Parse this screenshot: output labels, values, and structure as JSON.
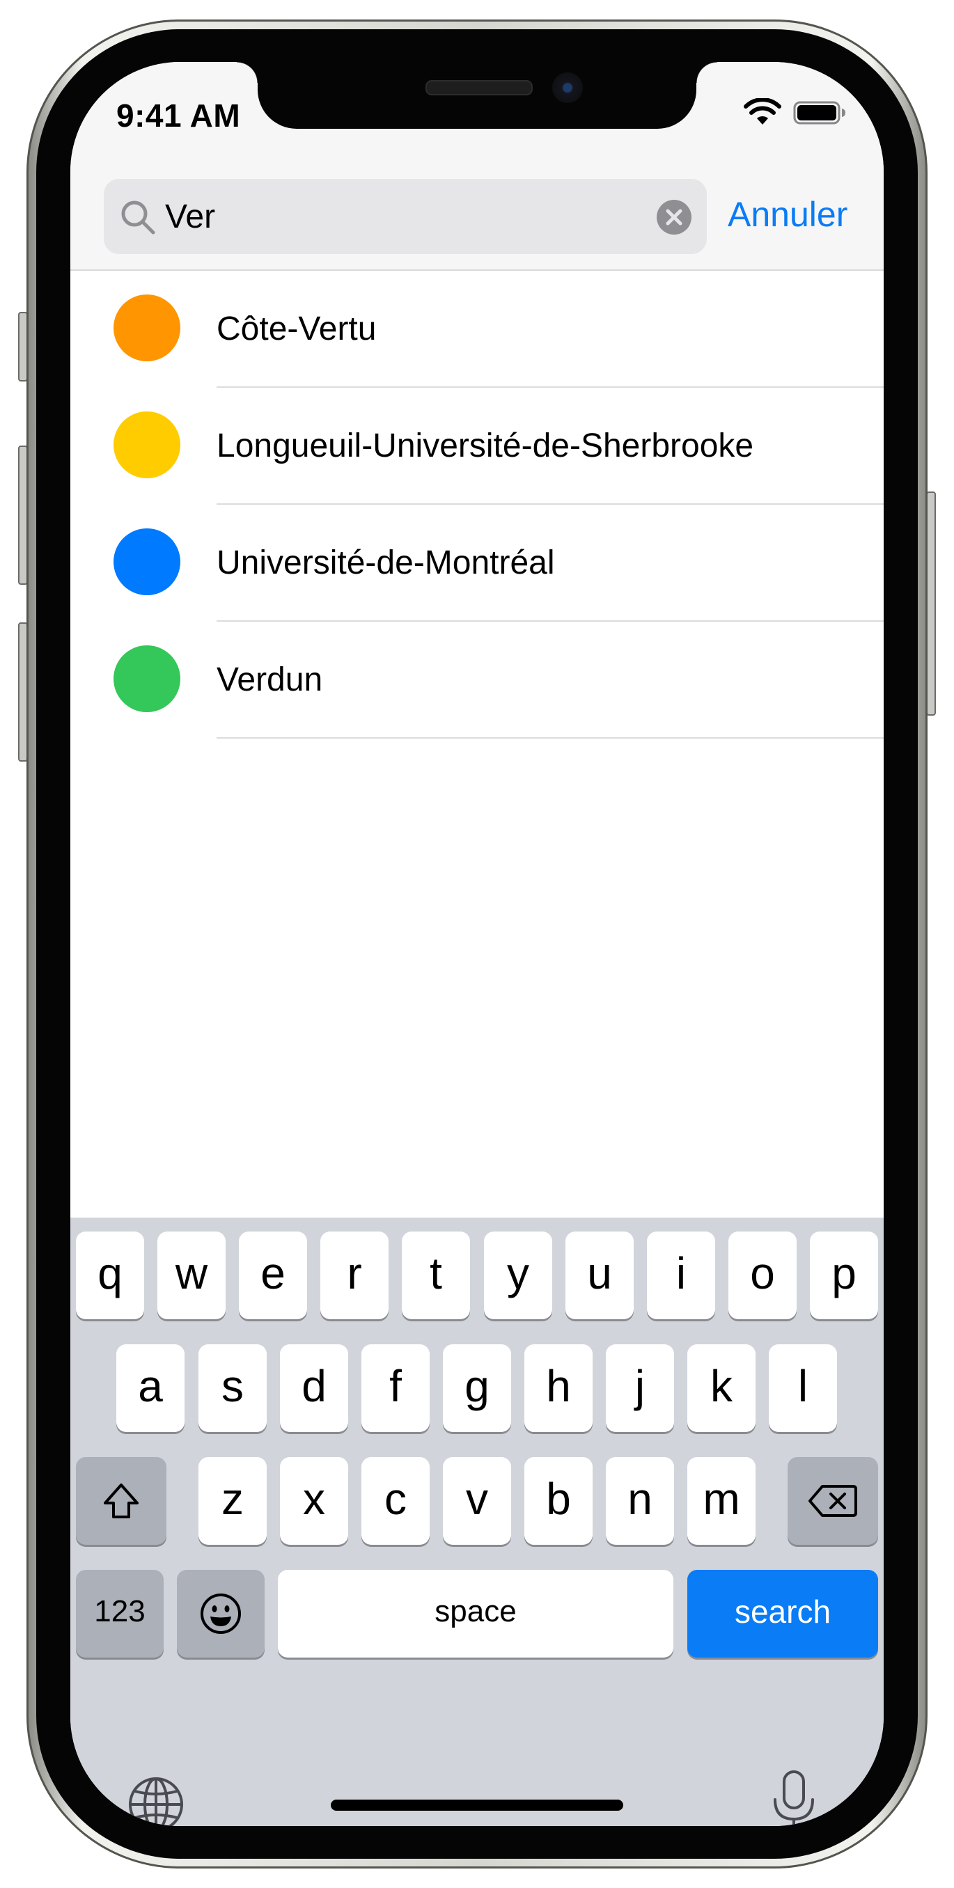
{
  "status_bar": {
    "time": "9:41 AM"
  },
  "search": {
    "value": "Ver",
    "cancel_label": "Annuler"
  },
  "results": [
    {
      "name": "Côte-Vertu",
      "color": "#ff9500"
    },
    {
      "name": "Longueuil-Université-de-Sherbrooke",
      "color": "#ffcc00"
    },
    {
      "name": "Université-de-Montréal",
      "color": "#007aff"
    },
    {
      "name": "Verdun",
      "color": "#34c759"
    }
  ],
  "keyboard": {
    "row1": [
      "q",
      "w",
      "e",
      "r",
      "t",
      "y",
      "u",
      "i",
      "o",
      "p"
    ],
    "row2": [
      "a",
      "s",
      "d",
      "f",
      "g",
      "h",
      "j",
      "k",
      "l"
    ],
    "row3": [
      "z",
      "x",
      "c",
      "v",
      "b",
      "n",
      "m"
    ],
    "numbers_label": "123",
    "space_label": "space",
    "search_label": "search",
    "icons": [
      "shift-icon",
      "delete-icon",
      "emoji-icon",
      "globe-icon",
      "microphone-icon"
    ]
  },
  "colors": {
    "accent": "#0a7cf5"
  }
}
